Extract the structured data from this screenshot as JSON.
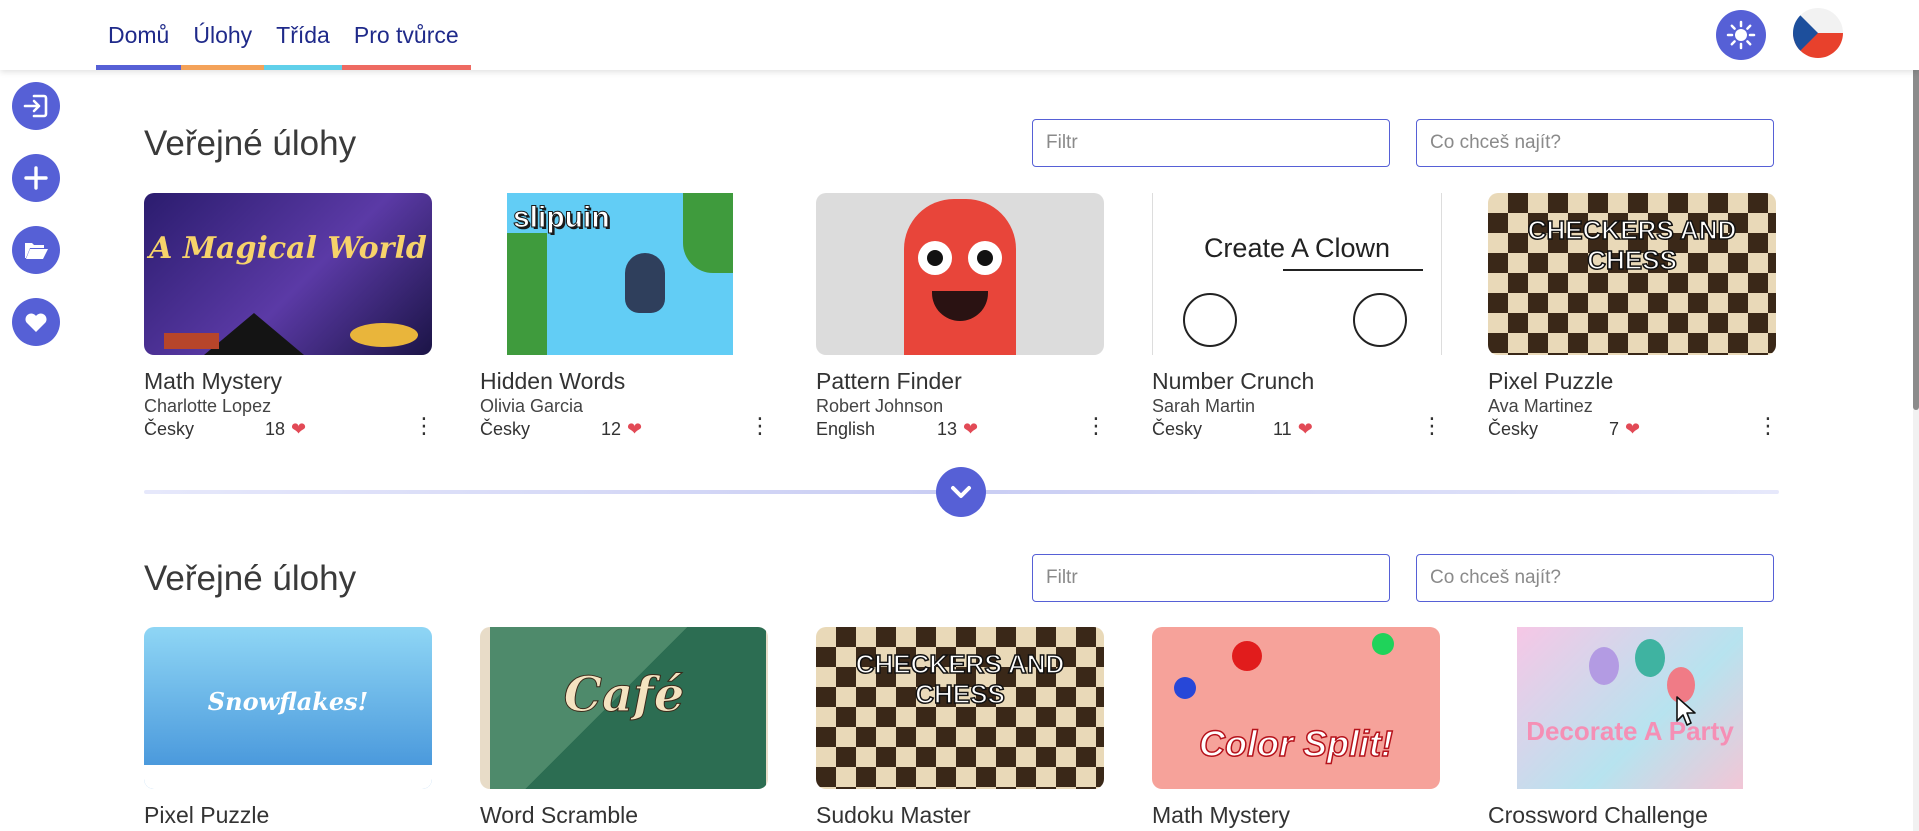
{
  "nav": {
    "tabs": [
      {
        "label": "Domů",
        "color": "#5660d6"
      },
      {
        "label": "Úlohy",
        "color": "#f4a259"
      },
      {
        "label": "Třída",
        "color": "#60d0ea"
      },
      {
        "label": "Pro tvůrce",
        "color": "#ee6a62"
      }
    ]
  },
  "header": {
    "theme_icon": "sun-icon",
    "language_flag": "czech-flag-icon"
  },
  "sidebar": {
    "items": [
      {
        "icon": "login-icon"
      },
      {
        "icon": "plus-icon"
      },
      {
        "icon": "folder-open-icon"
      },
      {
        "icon": "heart-icon"
      }
    ]
  },
  "sections": [
    {
      "title": "Veřejné úlohy",
      "filter_placeholder": "Filtr",
      "search_placeholder": "Co chceš najít?",
      "cards": [
        {
          "title": "Math Mystery",
          "author": "Charlotte Lopez",
          "language": "Česky",
          "likes": "18",
          "thumb_text": "A Magical World"
        },
        {
          "title": "Hidden Words",
          "author": "Olivia Garcia",
          "language": "Česky",
          "likes": "12",
          "thumb_text": "slipuin"
        },
        {
          "title": "Pattern Finder",
          "author": "Robert Johnson",
          "language": "English",
          "likes": "13",
          "thumb_text": ""
        },
        {
          "title": "Number Crunch",
          "author": "Sarah Martin",
          "language": "Česky",
          "likes": "11",
          "thumb_text": "Create A Clown"
        },
        {
          "title": "Pixel Puzzle",
          "author": "Ava Martinez",
          "language": "Česky",
          "likes": "7",
          "thumb_text": "CHECKERS AND CHESS"
        }
      ]
    },
    {
      "title": "Veřejné úlohy",
      "filter_placeholder": "Filtr",
      "search_placeholder": "Co chceš najít?",
      "cards": [
        {
          "title": "Pixel Puzzle",
          "thumb_text": "Snowflakes!"
        },
        {
          "title": "Word Scramble",
          "thumb_text": "Café"
        },
        {
          "title": "Sudoku Master",
          "thumb_text": "CHECKERS AND CHESS"
        },
        {
          "title": "Math Mystery",
          "thumb_text": "Color Split!"
        },
        {
          "title": "Crossword Challenge",
          "thumb_text": "Decorate A Party"
        }
      ]
    }
  ],
  "colors": {
    "accent": "#5660d6",
    "heart": "#e24a56"
  }
}
